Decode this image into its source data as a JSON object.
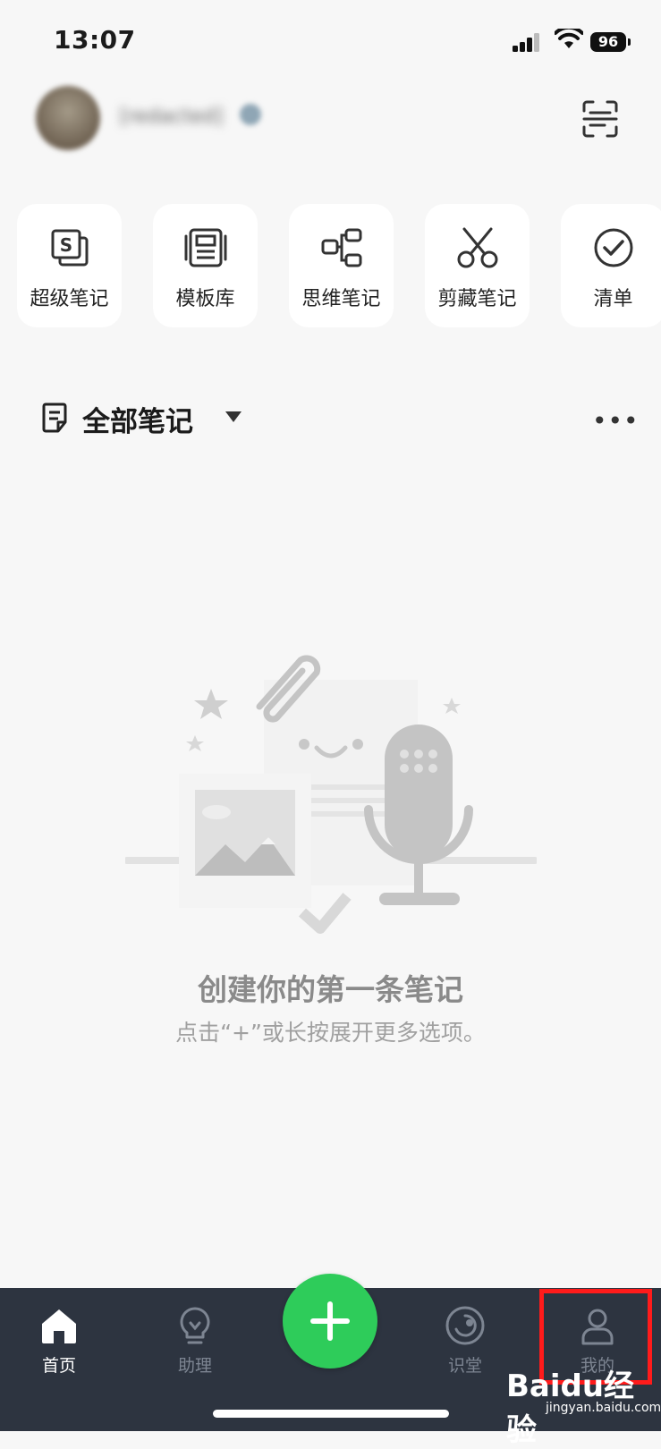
{
  "status_bar": {
    "time": "13:07",
    "battery": "96"
  },
  "header": {
    "username": "[redacted]"
  },
  "quick_actions": [
    {
      "label": "超级笔记",
      "icon": "super-note-icon"
    },
    {
      "label": "模板库",
      "icon": "template-icon"
    },
    {
      "label": "思维笔记",
      "icon": "mindmap-icon"
    },
    {
      "label": "剪藏笔记",
      "icon": "scissors-icon"
    },
    {
      "label": "清单",
      "icon": "checklist-icon"
    }
  ],
  "notes": {
    "title": "全部笔记",
    "more": "•••"
  },
  "empty_state": {
    "title": "创建你的第一条笔记",
    "subtitle": "点击“+”或长按展开更多选项。"
  },
  "tabbar": {
    "items": [
      {
        "label": "首页",
        "icon": "home-icon",
        "active": true
      },
      {
        "label": "助理",
        "icon": "lightbulb-icon",
        "active": false
      },
      {
        "label": "识堂",
        "icon": "target-icon",
        "active": false
      },
      {
        "label": "我的",
        "icon": "user-icon",
        "active": false
      }
    ],
    "fab_icon": "plus-icon"
  },
  "watermark": {
    "logo": "Baidu经验",
    "url": "jingyan.baidu.com"
  },
  "colors": {
    "accent": "#2ecc5a",
    "tabbar_bg": "#2d3440",
    "highlight": "#ff1b1b"
  }
}
